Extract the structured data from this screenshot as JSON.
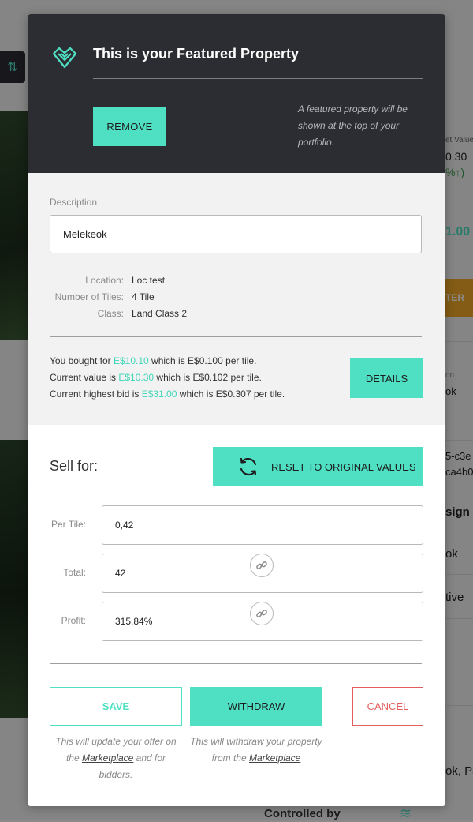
{
  "background": {
    "market_value_label": "et Value",
    "market_value": "0.30",
    "market_value_pct": "%↑)",
    "price": "1.00",
    "action_label": "TER",
    "location_label": "on",
    "location_value": "ok",
    "hash_line1": "5-c3e",
    "hash_line2": "ca4b0",
    "assign_label": "sign",
    "name_value": "ok",
    "status_value": "tive",
    "name_value2": "ok, Pa",
    "controlled_by": "Controlled by"
  },
  "modal": {
    "title": "This is your Featured Property",
    "remove_label": "REMOVE",
    "featured_note": "A featured property will be shown at the top of your portfolio.",
    "description": {
      "label": "Description",
      "value": "Melekeok"
    },
    "properties": [
      {
        "label": "Location:",
        "value": "Loc test"
      },
      {
        "label": "Number of Tiles:",
        "value": "4 Tile"
      },
      {
        "label": "Class:",
        "value": "Land Class 2"
      }
    ],
    "prices": {
      "bought_prefix": "You bought for ",
      "bought_amount": "E$10.10",
      "bought_suffix": " which is E$0.100 per tile.",
      "current_prefix": "Current value is ",
      "current_amount": "E$10.30",
      "current_suffix": " which is E$0.102 per tile.",
      "bid_prefix": "Current highest bid is ",
      "bid_amount": "E$31.00",
      "bid_suffix": " which is E$0.307 per tile."
    },
    "details_label": "DETAILS",
    "sell": {
      "label": "Sell for:",
      "reset_label": "RESET TO ORIGINAL VALUES",
      "fields": [
        {
          "label": "Per Tile:",
          "value": "0,42"
        },
        {
          "label": "Total:",
          "value": "42"
        },
        {
          "label": "Profit:",
          "value": "315,84%"
        }
      ]
    },
    "actions": {
      "save_label": "SAVE",
      "withdraw_label": "WITHDRAW",
      "cancel_label": "CANCEL",
      "save_note_pre": "This will update your offer on the ",
      "save_note_link": "Marketplace",
      "save_note_post": " and for bidders.",
      "withdraw_note_pre": "This will withdraw your property from the ",
      "withdraw_note_link": "Marketplace"
    }
  },
  "colors": {
    "accent": "#4fe0c4",
    "header_bg": "#2c2d33",
    "cancel": "#e45d5d"
  }
}
